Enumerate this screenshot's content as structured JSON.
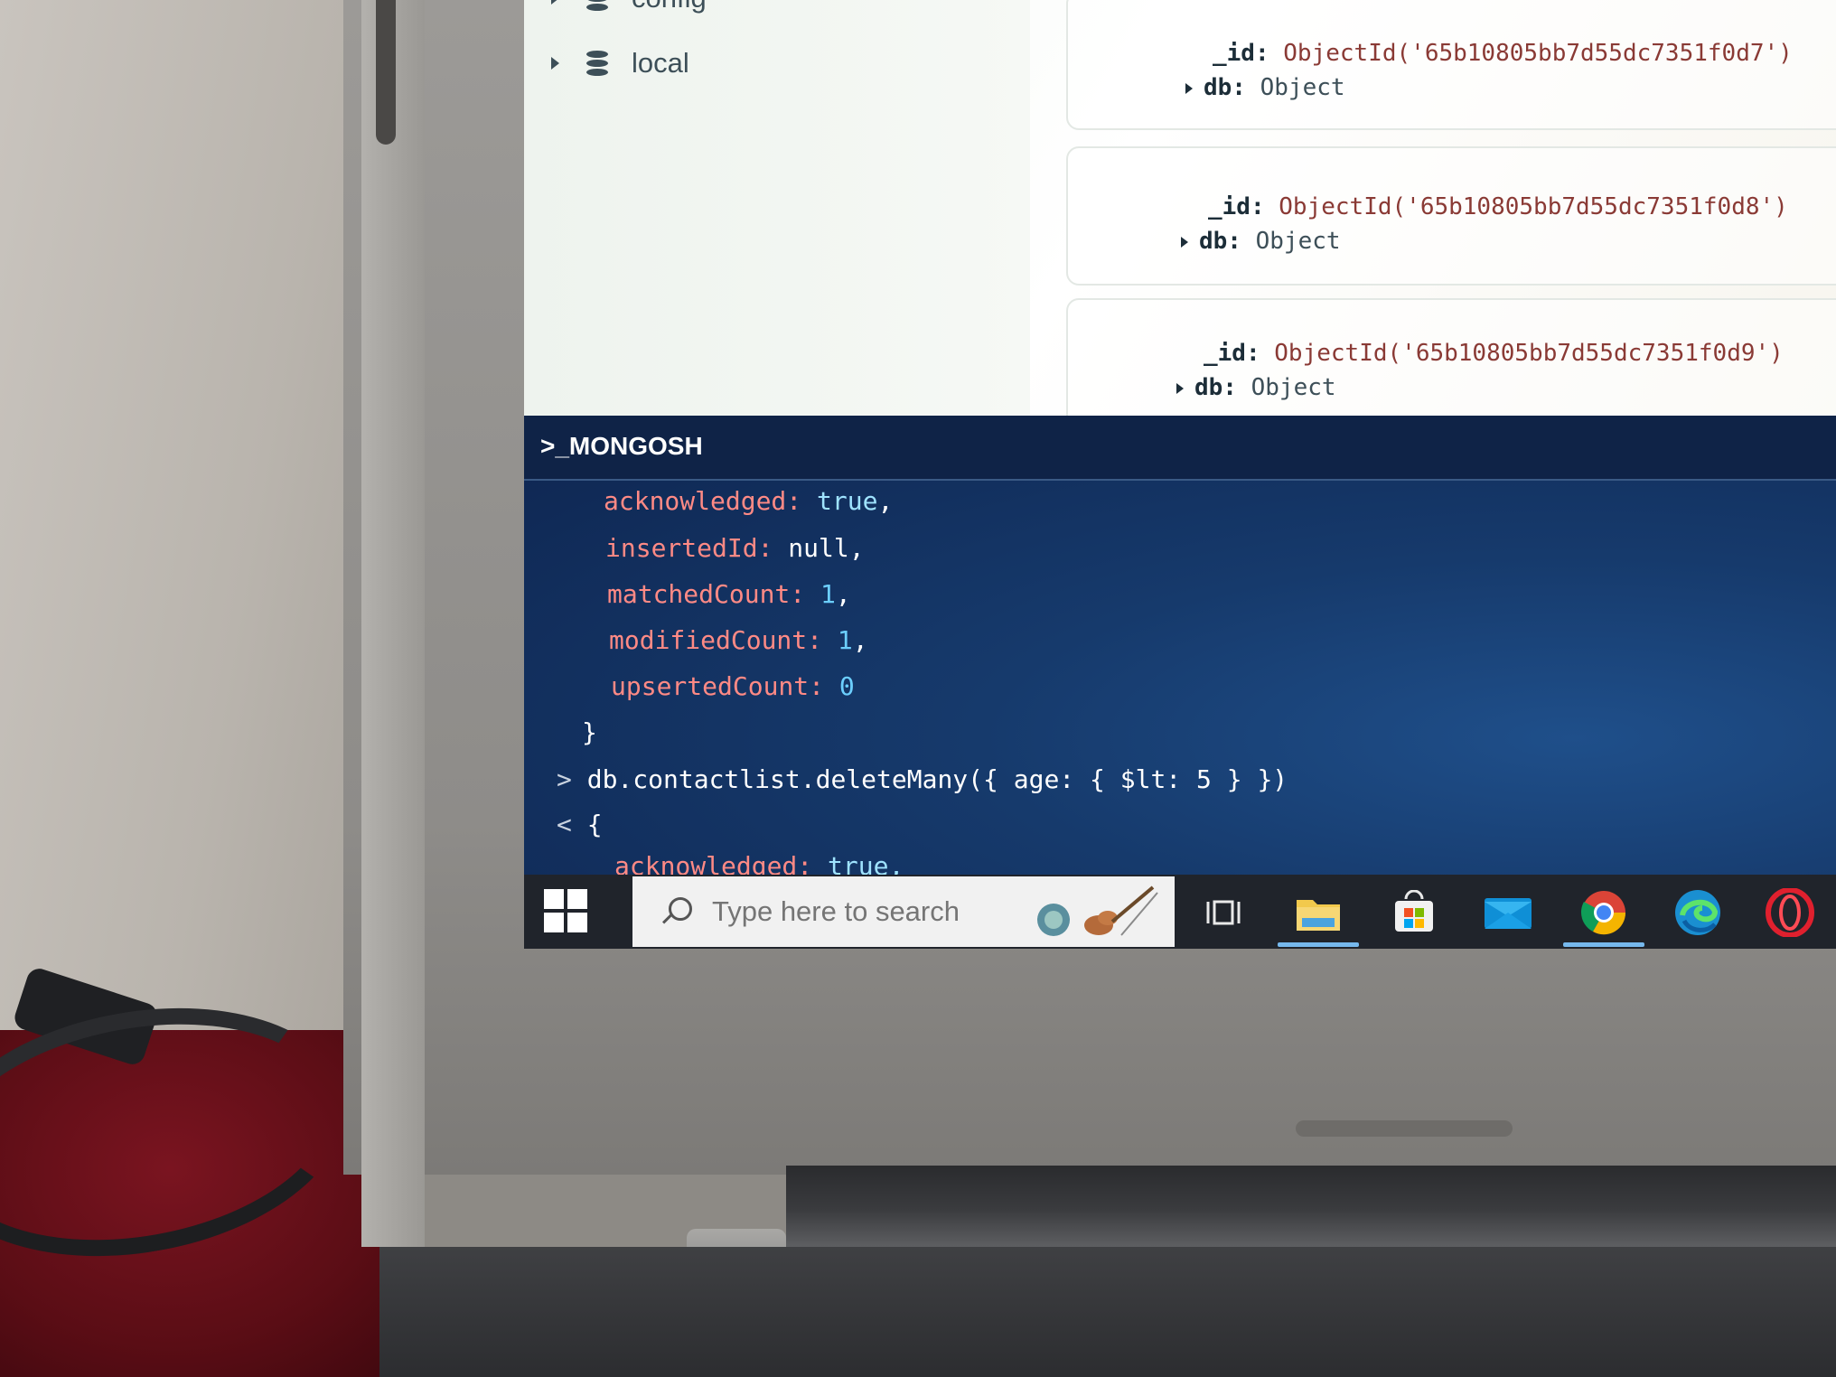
{
  "sidebar": {
    "items": [
      {
        "label": "config"
      },
      {
        "label": "local"
      }
    ]
  },
  "documents": [
    {
      "id_key": "_id:",
      "id_value": "ObjectId('65b10805bb7d55dc7351f0d7')",
      "db_key": "db:",
      "db_value": "Object"
    },
    {
      "id_key": "_id:",
      "id_value": "ObjectId('65b10805bb7d55dc7351f0d8')",
      "db_key": "db:",
      "db_value": "Object"
    },
    {
      "id_key": "_id:",
      "id_value": "ObjectId('65b10805bb7d55dc7351f0d9')",
      "db_key": "db:",
      "db_value": "Object"
    }
  ],
  "shell": {
    "title": ">_MONGOSH",
    "result": {
      "acknowledged_key": "acknowledged:",
      "acknowledged_val": "true",
      "insertedId_key": "insertedId:",
      "insertedId_val": "null",
      "matchedCount_key": "matchedCount:",
      "matchedCount_val": "1",
      "modifiedCount_key": "modifiedCount:",
      "modifiedCount_val": "1",
      "upsertedCount_key": "upsertedCount:",
      "upsertedCount_val": "0",
      "close_brace": "}"
    },
    "command_prompt": ">",
    "command": "db.contactlist.deleteMany({ age: { $lt: 5 } })",
    "output_prompt": "<",
    "output_open": "{",
    "partial_line_key": "acknowledged:",
    "partial_line_val": "true,"
  },
  "taskbar": {
    "search_placeholder": "Type here to search",
    "icons": [
      "windows-start-icon",
      "task-view-icon",
      "file-explorer-icon",
      "microsoft-store-icon",
      "mail-icon",
      "chrome-icon",
      "edge-icon",
      "opera-icon"
    ]
  }
}
